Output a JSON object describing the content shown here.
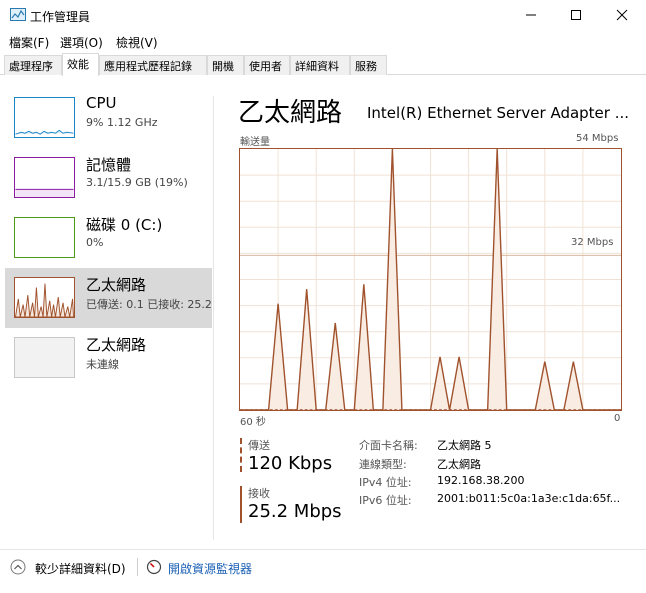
{
  "window": {
    "title": "工作管理員",
    "controls": [
      "minimize",
      "maximize",
      "close"
    ]
  },
  "menu": [
    "檔案(F)",
    "選項(O)",
    "檢視(V)"
  ],
  "tabs": [
    {
      "label": "處理程序",
      "active": false
    },
    {
      "label": "效能",
      "active": true
    },
    {
      "label": "應用程式歷程記錄",
      "active": false
    },
    {
      "label": "開機",
      "active": false
    },
    {
      "label": "使用者",
      "active": false
    },
    {
      "label": "詳細資料",
      "active": false
    },
    {
      "label": "服務",
      "active": false
    }
  ],
  "sidebar": {
    "items": [
      {
        "title": "CPU",
        "subtitle": "9% 1.12 GHz",
        "color": "#1a85c7"
      },
      {
        "title": "記憶體",
        "subtitle": "3.1/15.9 GB (19%)",
        "color": "#8b1ba3"
      },
      {
        "title": "磁碟 0 (C:)",
        "subtitle": "0%",
        "color": "#4c9a1c"
      },
      {
        "title": "乙太網路",
        "subtitle": "已傳送: 0.1 已接收: 25.2",
        "color": "#a0522d",
        "selected": true
      },
      {
        "title": "乙太網路",
        "subtitle": "未連線",
        "color": "#b0b0b0"
      }
    ]
  },
  "main": {
    "title": "乙太網路",
    "adapter": "Intel(R) Ethernet Server Adapter ...",
    "chart_left_label": "輸送量",
    "chart_max_label": "54 Mbps",
    "chart_mid_label": "32 Mbps",
    "chart_time_left": "60 秒",
    "chart_time_right": "0",
    "chart_color": "#a0522d"
  },
  "chart_data": {
    "type": "area",
    "title": "輸送量",
    "xlabel": "",
    "ylabel": "",
    "xlim": [
      60,
      0
    ],
    "ylim": [
      0,
      54
    ],
    "y_reference_lines": [
      32
    ],
    "x_tick_labels": [
      "60 秒",
      "0"
    ],
    "x": [
      60,
      58.5,
      57,
      55.5,
      54,
      52.5,
      51,
      49.5,
      48,
      46.5,
      45,
      43.5,
      42,
      40.5,
      39,
      37.5,
      36,
      34.5,
      33,
      31.5,
      30,
      28.5,
      27,
      25.5,
      24,
      22.5,
      21,
      19.5,
      18,
      16.5,
      15,
      13.5,
      12,
      10.5,
      9,
      7.5,
      6,
      4.5,
      3,
      1.5,
      0
    ],
    "series": [
      {
        "values": [
          0,
          0,
          0,
          0,
          22,
          0,
          0,
          25,
          0,
          0,
          18,
          0,
          0,
          26,
          0,
          0,
          54,
          0,
          0,
          0,
          0,
          11,
          0,
          11,
          0,
          0,
          0,
          54,
          0,
          0,
          0,
          0,
          10,
          0,
          0,
          10,
          0,
          0,
          0,
          0,
          0
        ]
      },
      {
        "values": [
          0,
          0,
          0,
          0,
          0,
          0,
          0,
          0,
          0,
          0,
          0,
          0,
          0,
          0,
          0,
          0,
          0,
          0,
          0,
          0,
          0,
          0,
          0,
          0,
          0,
          0,
          0,
          0,
          0,
          0,
          0,
          0,
          0,
          0,
          0,
          0,
          0,
          0,
          0,
          0,
          0
        ]
      }
    ]
  },
  "stats": {
    "send_label": "傳送",
    "send_value": "120 Kbps",
    "recv_label": "接收",
    "recv_value": "25.2 Mbps"
  },
  "info": [
    {
      "key": "介面卡名稱:",
      "value": "乙太網路 5"
    },
    {
      "key": "連線類型:",
      "value": "乙太網路"
    },
    {
      "key": "IPv4 位址:",
      "value": "192.168.38.200"
    },
    {
      "key": "IPv6 位址:",
      "value": "2001:b011:5c0a:1a3e:c1da:65f..."
    }
  ],
  "footer": {
    "less_details": "較少詳細資料(D)",
    "resource_monitor": "開啟資源監視器"
  }
}
